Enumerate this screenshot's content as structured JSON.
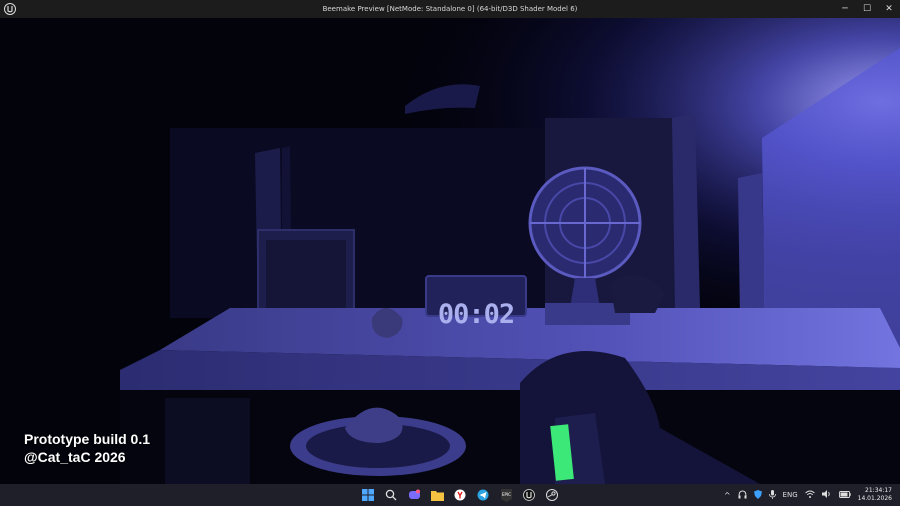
{
  "window": {
    "title": "Beemake Preview [NetMode: Standalone 0]  (64-bit/D3D Shader Model 6)",
    "minimize": "─",
    "maximize": "☐",
    "close": "✕"
  },
  "game": {
    "timer": "00:02",
    "build_label": "Prototype build 0.1",
    "author_label": "@Cat_taC 2026",
    "accent_color": "#5050c8",
    "battery_color": "#3ce878"
  },
  "taskbar": {
    "apps": [
      "windows-start-icon",
      "search-icon",
      "chat-icon",
      "file-explorer-icon",
      "browser-icon",
      "telegram-icon",
      "epic-games-icon",
      "unreal-engine-icon",
      "steam-icon"
    ],
    "language": "ENG",
    "time": "21:34:17",
    "date": "14.01.2026"
  }
}
